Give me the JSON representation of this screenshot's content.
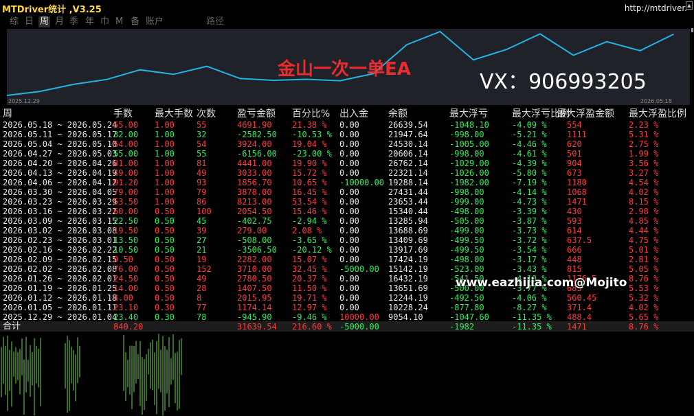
{
  "app": {
    "title": "MTDriver统计 ,V3.25",
    "url": "http://mtdriver."
  },
  "tabs": [
    {
      "label": "综",
      "active": false
    },
    {
      "label": "日",
      "active": false
    },
    {
      "label": "周",
      "active": true
    },
    {
      "label": "月",
      "active": false
    },
    {
      "label": "季",
      "active": false
    },
    {
      "label": "年",
      "active": false
    },
    {
      "label": "巾",
      "active": false
    },
    {
      "label": "M",
      "active": false
    },
    {
      "label": "备",
      "active": false
    },
    {
      "label": "账户",
      "active": false
    },
    {
      "label": "路径",
      "active": false
    }
  ],
  "overlay": {
    "title": "金山一次一单EA",
    "vx": "VX：906993205",
    "website": "www.eazhijia.com@Mojito"
  },
  "chart_data": {
    "type": "line",
    "x_start_label": "2025.12.29",
    "x_end_label": "2026.05.18",
    "x": [
      "2025.12.29",
      "2026.01.05",
      "2026.01.12",
      "2026.01.19",
      "2026.01.26",
      "2026.02.02",
      "2026.02.09",
      "2026.02.16",
      "2026.02.23",
      "2026.03.02",
      "2026.03.09",
      "2026.03.16",
      "2026.03.23",
      "2026.03.30",
      "2026.04.06",
      "2026.04.13",
      "2026.04.20",
      "2026.04.27",
      "2026.05.04",
      "2026.05.11",
      "2026.05.18"
    ],
    "values": [
      9054.1,
      10228.24,
      12244.19,
      13651.69,
      16432.19,
      15142.19,
      17424.19,
      13917.69,
      13409.69,
      13688.69,
      13285.94,
      15340.44,
      23653.44,
      27431.44,
      19288.14,
      22321.14,
      26762.14,
      20606.14,
      24530.14,
      21947.64,
      26639.54
    ],
    "color": "#22b4e6"
  },
  "table": {
    "headers": [
      "周",
      "手数",
      "最大手数",
      "次数",
      "盈亏金额",
      "百分比%",
      "出入金",
      "余额",
      "最大浮亏",
      "最大浮亏比例",
      "最大浮盈金额",
      "最大浮盈比例"
    ],
    "rows": [
      {
        "week": "2026.05.18 ~ 2026.05.24",
        "lots": "55.00",
        "max_lots": "1.00",
        "count": "55",
        "pnl": "4691.90",
        "pct": "21.38 %",
        "io": "0.00",
        "balance": "26639.54",
        "max_dd": "-1048.10",
        "dd_pct": "-4.09 %",
        "max_fp": "554",
        "fp_pct": "2.23 %",
        "sign": "r"
      },
      {
        "week": "2026.05.11 ~ 2026.05.17",
        "lots": "32.00",
        "max_lots": "1.00",
        "count": "32",
        "pnl": "-2582.50",
        "pct": "-10.53 %",
        "io": "0.00",
        "balance": "21947.64",
        "max_dd": "-998.00",
        "dd_pct": "-5.21 %",
        "max_fp": "1111",
        "fp_pct": "5.31 %",
        "sign": "g"
      },
      {
        "week": "2026.05.04 ~ 2026.05.10",
        "lots": "54.00",
        "max_lots": "1.00",
        "count": "54",
        "pnl": "3924.00",
        "pct": "19.04 %",
        "io": "0.00",
        "balance": "24530.14",
        "max_dd": "-1005.00",
        "dd_pct": "-4.46 %",
        "max_fp": "620",
        "fp_pct": "2.75 %",
        "sign": "r"
      },
      {
        "week": "2026.04.27 ~ 2026.05.03",
        "lots": "55.00",
        "max_lots": "1.00",
        "count": "55",
        "pnl": "-6156.00",
        "pct": "-23.00 %",
        "io": "0.00",
        "balance": "20606.14",
        "max_dd": "-998.00",
        "dd_pct": "-4.61 %",
        "max_fp": "501",
        "fp_pct": "1.99 %",
        "sign": "g"
      },
      {
        "week": "2026.04.20 ~ 2026.04.26",
        "lots": "81.00",
        "max_lots": "1.00",
        "count": "81",
        "pnl": "4441.00",
        "pct": "19.90 %",
        "io": "0.00",
        "balance": "26762.14",
        "max_dd": "-1029.00",
        "dd_pct": "-4.39 %",
        "max_fp": "904",
        "fp_pct": "3.56 %",
        "sign": "r"
      },
      {
        "week": "2026.04.13 ~ 2026.04.19",
        "lots": "49.00",
        "max_lots": "1.00",
        "count": "49",
        "pnl": "3033.00",
        "pct": "15.72 %",
        "io": "0.00",
        "balance": "22321.14",
        "max_dd": "-1026.00",
        "dd_pct": "-5.80 %",
        "max_fp": "673",
        "fp_pct": "3.27 %",
        "sign": "r"
      },
      {
        "week": "2026.04.06 ~ 2026.04.12",
        "lots": "91.20",
        "max_lots": "1.00",
        "count": "93",
        "pnl": "1856.70",
        "pct": "10.65 %",
        "io": "-10000.00",
        "balance": "19288.14",
        "max_dd": "-1982.00",
        "dd_pct": "-7.19 %",
        "max_fp": "1180",
        "fp_pct": "4.54 %",
        "sign": "r"
      },
      {
        "week": "2026.03.30 ~ 2026.04.05",
        "lots": "79.00",
        "max_lots": "1.00",
        "count": "79",
        "pnl": "3878.00",
        "pct": "16.45 %",
        "io": "0.00",
        "balance": "27431.44",
        "max_dd": "-998.00",
        "dd_pct": "-4.14 %",
        "max_fp": "1068",
        "fp_pct": "4.02 %",
        "sign": "r"
      },
      {
        "week": "2026.03.23 ~ 2026.03.29",
        "lots": "53.50",
        "max_lots": "1.00",
        "count": "86",
        "pnl": "8213.00",
        "pct": "53.54 %",
        "io": "0.00",
        "balance": "23653.44",
        "max_dd": "-999.00",
        "dd_pct": "-4.73 %",
        "max_fp": "1471",
        "fp_pct": "8.15 %",
        "sign": "r"
      },
      {
        "week": "2026.03.16 ~ 2026.03.22",
        "lots": "60.00",
        "max_lots": "0.50",
        "count": "100",
        "pnl": "2054.50",
        "pct": "15.46 %",
        "io": "0.00",
        "balance": "15340.44",
        "max_dd": "-498.00",
        "dd_pct": "-3.39 %",
        "max_fp": "430",
        "fp_pct": "2.98 %",
        "sign": "r"
      },
      {
        "week": "2026.03.09 ~ 2026.03.15",
        "lots": "22.50",
        "max_lots": "0.50",
        "count": "45",
        "pnl": "-402.75",
        "pct": "-2.94 %",
        "io": "0.00",
        "balance": "13285.94",
        "max_dd": "-505.00",
        "dd_pct": "-3.87 %",
        "max_fp": "593",
        "fp_pct": "4.85 %",
        "sign": "g"
      },
      {
        "week": "2026.03.02 ~ 2026.03.08",
        "lots": "19.50",
        "max_lots": "0.50",
        "count": "39",
        "pnl": "279.00",
        "pct": "2.08 %",
        "io": "0.00",
        "balance": "13688.69",
        "max_dd": "-499.00",
        "dd_pct": "-3.73 %",
        "max_fp": "614",
        "fp_pct": "4.44 %",
        "sign": "r"
      },
      {
        "week": "2026.02.23 ~ 2026.03.01",
        "lots": "13.50",
        "max_lots": "0.50",
        "count": "27",
        "pnl": "-508.00",
        "pct": "-3.65 %",
        "io": "0.00",
        "balance": "13409.69",
        "max_dd": "-499.50",
        "dd_pct": "-3.72 %",
        "max_fp": "637.5",
        "fp_pct": "4.75 %",
        "sign": "g"
      },
      {
        "week": "2026.02.16 ~ 2026.02.22",
        "lots": "10.50",
        "max_lots": "0.50",
        "count": "21",
        "pnl": "-3506.50",
        "pct": "-20.12 %",
        "io": "0.00",
        "balance": "13917.69",
        "max_dd": "-499.50",
        "dd_pct": "-3.54 %",
        "max_fp": "666",
        "fp_pct": "5.01 %",
        "sign": "g"
      },
      {
        "week": "2026.02.09 ~ 2026.02.15",
        "lots": "9.50",
        "max_lots": "0.50",
        "count": "19",
        "pnl": "2282.00",
        "pct": "15.07 %",
        "io": "0.00",
        "balance": "17424.19",
        "max_dd": "-498.00",
        "dd_pct": "-3.17 %",
        "max_fp": "448",
        "fp_pct": "2.81 %",
        "sign": "r"
      },
      {
        "week": "2026.02.02 ~ 2026.02.08",
        "lots": "76.00",
        "max_lots": "0.50",
        "count": "152",
        "pnl": "3710.00",
        "pct": "32.45 %",
        "io": "-5000.00",
        "balance": "15142.19",
        "max_dd": "-523.00",
        "dd_pct": "-3.43 %",
        "max_fp": "815",
        "fp_pct": "5.05 %",
        "sign": "r"
      },
      {
        "week": "2026.01.26 ~ 2026.02.01",
        "lots": "24.50",
        "max_lots": "0.50",
        "count": "49",
        "pnl": "2780.50",
        "pct": "20.37 %",
        "io": "0.00",
        "balance": "16432.19",
        "max_dd": "-541.50",
        "dd_pct": "-4.10 %",
        "max_fp": "1176.5",
        "fp_pct": "8.76 %",
        "sign": "r"
      },
      {
        "week": "2026.01.19 ~ 2026.01.25",
        "lots": "14.00",
        "max_lots": "0.50",
        "count": "28",
        "pnl": "1407.50",
        "pct": "11.50 %",
        "io": "0.00",
        "balance": "13651.69",
        "max_dd": "-500.00",
        "dd_pct": "-3.77 %",
        "max_fp": "685",
        "fp_pct": "5.53 %",
        "sign": "r"
      },
      {
        "week": "2026.01.12 ~ 2026.01.18",
        "lots": "4.00",
        "max_lots": "0.50",
        "count": "8",
        "pnl": "2015.95",
        "pct": "19.71 %",
        "io": "0.00",
        "balance": "12244.19",
        "max_dd": "-492.50",
        "dd_pct": "-4.06 %",
        "max_fp": "560.45",
        "fp_pct": "5.32 %",
        "sign": "r"
      },
      {
        "week": "2026.01.05 ~ 2026.01.11",
        "lots": "23.10",
        "max_lots": "0.30",
        "count": "77",
        "pnl": "1174.14",
        "pct": "12.97 %",
        "io": "0.00",
        "balance": "10228.24",
        "max_dd": "-877.80",
        "dd_pct": "-8.27 %",
        "max_fp": "371.4",
        "fp_pct": "4.02 %",
        "sign": "r"
      },
      {
        "week": "2025.12.29 ~ 2026.01.04",
        "lots": "23.40",
        "max_lots": "0.30",
        "count": "78",
        "pnl": "-945.90",
        "pct": "-9.46 %",
        "io": "10000.00",
        "balance": "9054.10",
        "max_dd": "-1047.60",
        "dd_pct": "-11.35 %",
        "max_fp": "488.4",
        "fp_pct": "5.65 %",
        "sign": "g"
      }
    ],
    "total": {
      "label": "合计",
      "lots": "840.20",
      "pnl": "31639.54",
      "pct": "216.60 %",
      "io": "-5000.00",
      "max_dd": "-1982",
      "dd_pct": "-11.35 %",
      "max_fp": "1471",
      "fp_pct": "8.76 %"
    }
  },
  "colors": {
    "profit": "#ff3b3b",
    "loss": "#2ef05a",
    "neutral": "#e8e8e8",
    "line": "#22b4e6",
    "bars": "#6fd64a",
    "title": "#ffd84a"
  }
}
